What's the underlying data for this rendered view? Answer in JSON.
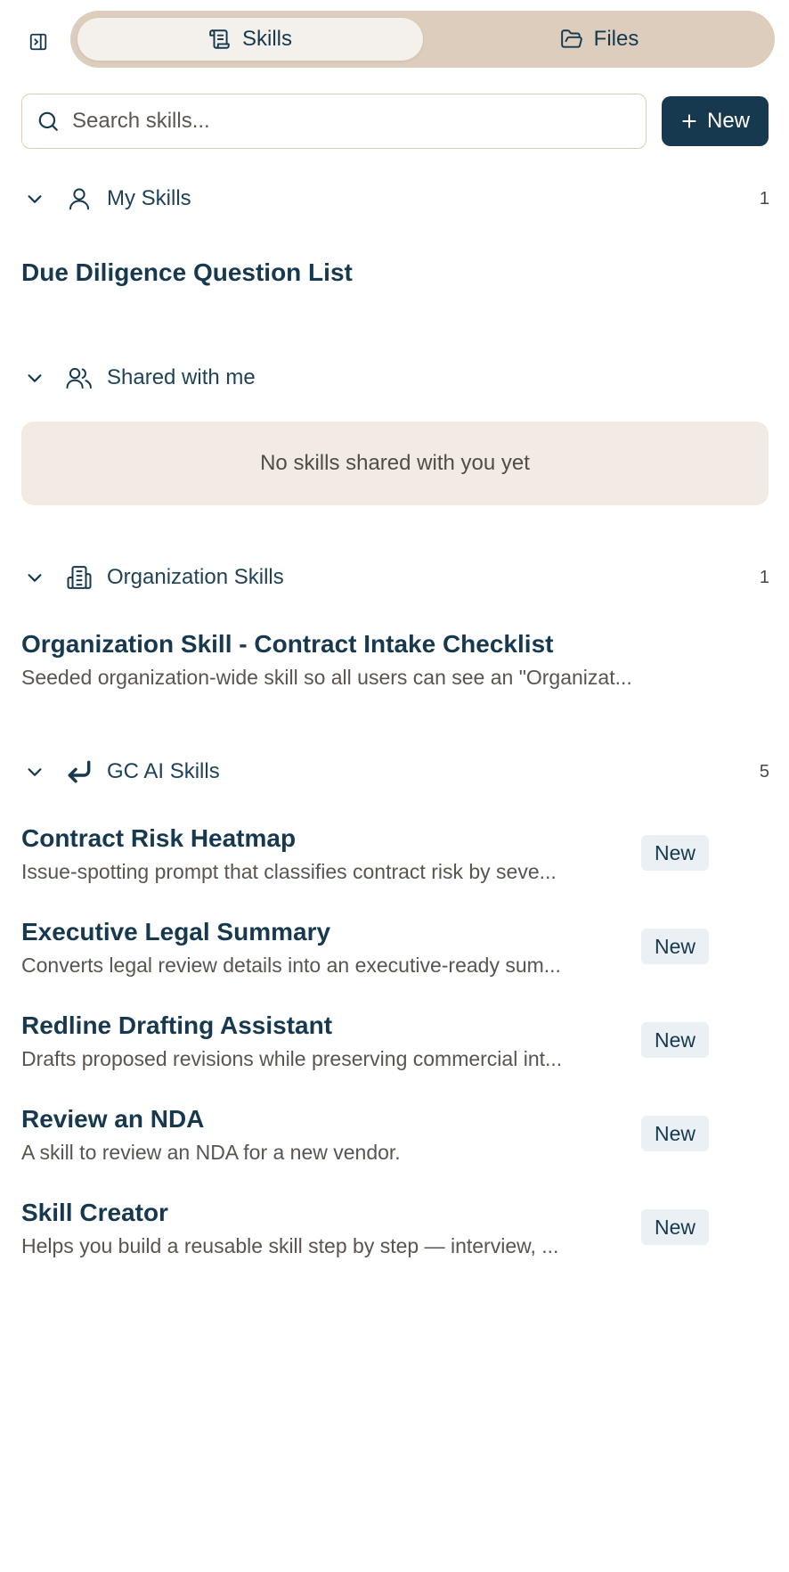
{
  "tabs": {
    "skills_label": "Skills",
    "files_label": "Files"
  },
  "search": {
    "placeholder": "Search skills..."
  },
  "new_button": {
    "label": "New"
  },
  "colors": {
    "primary": "#17394f",
    "tab_track": "#ddcdbd",
    "empty_bg": "#f2ebe3",
    "badge_bg": "#eaf0f3"
  },
  "sections": {
    "my_skills": {
      "title": "My Skills",
      "icon": "user-icon",
      "count": "1",
      "items": [
        {
          "title": "Due Diligence Question List"
        }
      ]
    },
    "shared": {
      "title": "Shared with me",
      "icon": "users-icon",
      "empty_text": "No skills shared with you yet"
    },
    "organization": {
      "title": "Organization Skills",
      "icon": "building-icon",
      "count": "1",
      "items": [
        {
          "title": "Organization Skill - Contract Intake Checklist",
          "description": "Seeded organization-wide skill so all users can see an \"Organizat..."
        }
      ]
    },
    "gc_ai": {
      "title": "GC AI Skills",
      "icon": "corner-down-left-icon",
      "count": "5",
      "items": [
        {
          "title": "Contract Risk Heatmap",
          "description": "Issue-spotting prompt that classifies contract risk by seve...",
          "badge": "New"
        },
        {
          "title": "Executive Legal Summary",
          "description": "Converts legal review details into an executive-ready sum...",
          "badge": "New"
        },
        {
          "title": "Redline Drafting Assistant",
          "description": "Drafts proposed revisions while preserving commercial int...",
          "badge": "New"
        },
        {
          "title": "Review an NDA",
          "description": "A skill to review an NDA for a new vendor.",
          "badge": "New"
        },
        {
          "title": "Skill Creator",
          "description": "Helps you build a reusable skill step by step — interview, ...",
          "badge": "New"
        }
      ]
    }
  }
}
